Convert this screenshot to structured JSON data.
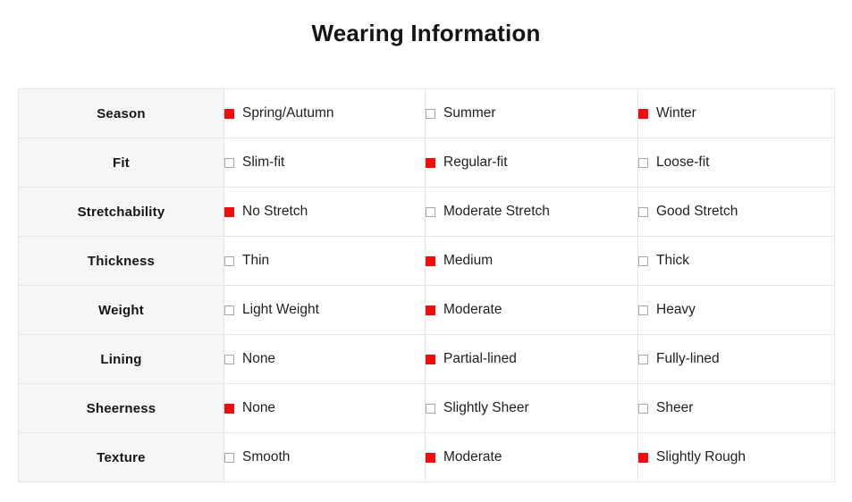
{
  "header": {
    "title": "Wearing Information"
  },
  "colors": {
    "checked_marker": "#f40c0c",
    "unchecked_border": "#a8a8a8",
    "label_cell_background": "#f6f6f6",
    "table_border": "#e6e6e6",
    "text": "#1f1f1f"
  },
  "table": {
    "rows": [
      {
        "label": "Season",
        "options": [
          {
            "label": "Spring/Autumn",
            "checked": true
          },
          {
            "label": "Summer",
            "checked": false
          },
          {
            "label": "Winter",
            "checked": true
          }
        ]
      },
      {
        "label": "Fit",
        "options": [
          {
            "label": "Slim-fit",
            "checked": false
          },
          {
            "label": "Regular-fit",
            "checked": true
          },
          {
            "label": "Loose-fit",
            "checked": false
          }
        ]
      },
      {
        "label": "Stretchability",
        "options": [
          {
            "label": "No Stretch",
            "checked": true
          },
          {
            "label": "Moderate Stretch",
            "checked": false
          },
          {
            "label": "Good Stretch",
            "checked": false
          }
        ]
      },
      {
        "label": "Thickness",
        "options": [
          {
            "label": "Thin",
            "checked": false
          },
          {
            "label": "Medium",
            "checked": true
          },
          {
            "label": "Thick",
            "checked": false
          }
        ]
      },
      {
        "label": "Weight",
        "options": [
          {
            "label": "Light Weight",
            "checked": false
          },
          {
            "label": "Moderate",
            "checked": true
          },
          {
            "label": "Heavy",
            "checked": false
          }
        ]
      },
      {
        "label": "Lining",
        "options": [
          {
            "label": "None",
            "checked": false
          },
          {
            "label": "Partial-lined",
            "checked": true
          },
          {
            "label": "Fully-lined",
            "checked": false
          }
        ]
      },
      {
        "label": "Sheerness",
        "options": [
          {
            "label": "None",
            "checked": true
          },
          {
            "label": "Slightly Sheer",
            "checked": false
          },
          {
            "label": "Sheer",
            "checked": false
          }
        ]
      },
      {
        "label": "Texture",
        "options": [
          {
            "label": "Smooth",
            "checked": false
          },
          {
            "label": "Moderate",
            "checked": true
          },
          {
            "label": "Slightly Rough",
            "checked": true
          }
        ]
      }
    ]
  }
}
